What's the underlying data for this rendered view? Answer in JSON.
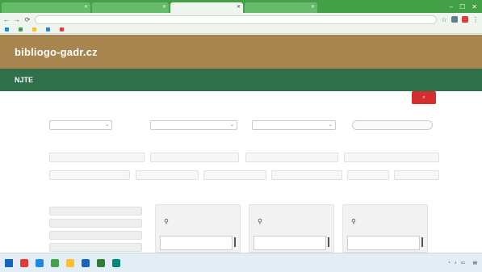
{
  "browser": {
    "tabs": [
      {
        "label": ""
      },
      {
        "label": ""
      },
      {
        "label": ""
      },
      {
        "label": ""
      }
    ],
    "address": "",
    "window_controls": [
      "–",
      "☐",
      "✕"
    ],
    "bookmarks": [
      {
        "label": "",
        "icon": "folder-icon"
      },
      {
        "label": "",
        "icon": "folder-icon"
      },
      {
        "label": "",
        "icon": "folder-icon"
      },
      {
        "label": "",
        "icon": "folder-icon"
      },
      {
        "label": "",
        "icon": "folder-icon"
      }
    ]
  },
  "site": {
    "logo": "bibliogo-gadr.cz",
    "top_nav": [
      "",
      "",
      "",
      ""
    ],
    "subnav_brand": "NJTE",
    "subnav_links": [
      "",
      "",
      "",
      ""
    ]
  },
  "filters": {
    "group1_label": "",
    "group1_value": "",
    "group2_label": "",
    "group2_value": "",
    "group3_label": "",
    "group3_value": "",
    "clear_label": "",
    "categories_label": "",
    "categories_row1": [
      "",
      "",
      "",
      ""
    ],
    "categories_row2": [
      "",
      "",
      "",
      "",
      "",
      ""
    ],
    "left_list_label": "",
    "left_list": [
      "",
      "",
      "",
      ""
    ],
    "results_label": "",
    "page_label": ""
  },
  "cards": [
    {
      "title": "",
      "text": "",
      "icon": "pin-icon"
    },
    {
      "title": "",
      "text": "",
      "icon": "pin-icon"
    },
    {
      "title": "",
      "text": "",
      "icon": "pin-icon"
    }
  ],
  "taskbar": {
    "clock_time": "",
    "clock_date": ""
  },
  "colors": {
    "tabbar": "#43a047",
    "header": "#a8844f",
    "subnav": "#2f6f4a",
    "accent_red": "#d32f2f"
  }
}
